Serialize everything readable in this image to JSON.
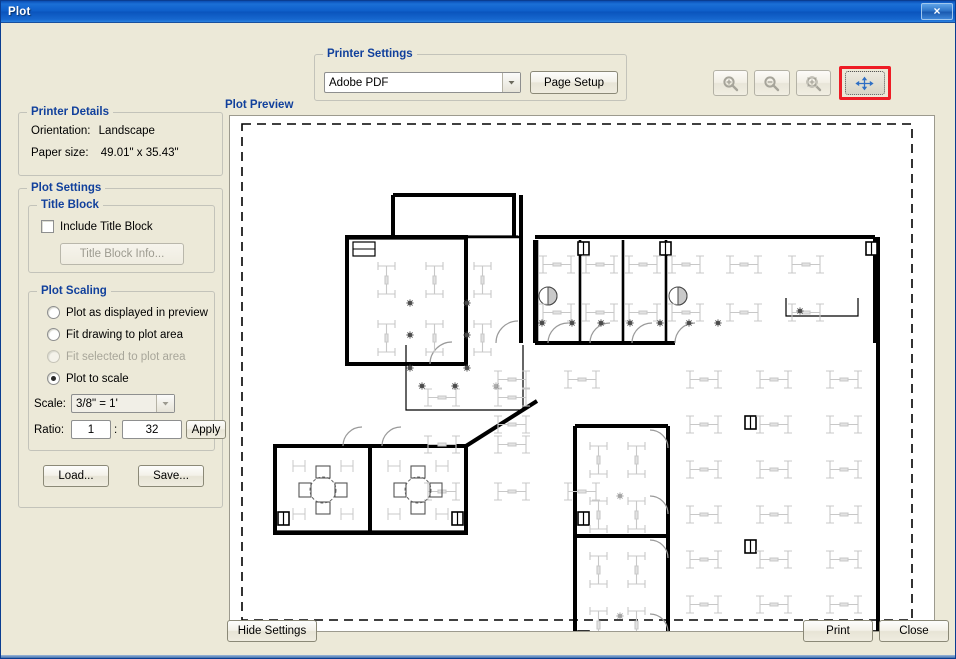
{
  "window": {
    "title": "Plot",
    "close_label": "×"
  },
  "printer_settings": {
    "legend": "Printer Settings",
    "printer_value": "Adobe PDF",
    "page_setup_label": "Page Setup"
  },
  "toolbar": {
    "zoom_in": "zoom-in-icon",
    "zoom_out": "zoom-out-icon",
    "zoom_fit": "zoom-fit-icon",
    "pan": "pan-move-icon",
    "highlight_color": "#ee1c25"
  },
  "printer_details": {
    "legend": "Printer Details",
    "orientation_label": "Orientation:",
    "orientation_value": "Landscape",
    "paper_label": "Paper size:",
    "paper_value": "49.01\" x 35.43\""
  },
  "plot_settings": {
    "legend": "Plot Settings",
    "title_block": {
      "legend": "Title Block",
      "include_label": "Include Title Block",
      "include_checked": false,
      "info_button": "Title Block Info...",
      "info_disabled": true
    },
    "plot_scaling": {
      "legend": "Plot Scaling",
      "options": [
        {
          "label": "Plot as displayed in preview",
          "selected": false,
          "disabled": false
        },
        {
          "label": "Fit drawing to plot area",
          "selected": false,
          "disabled": false
        },
        {
          "label": "Fit selected to plot area",
          "selected": false,
          "disabled": true
        },
        {
          "label": "Plot to scale",
          "selected": true,
          "disabled": false
        }
      ],
      "scale_label": "Scale:",
      "scale_value": "3/8\" = 1'",
      "ratio_label": "Ratio:",
      "ratio_numerator": "1",
      "ratio_separator": ":",
      "ratio_denominator": "32",
      "apply_label": "Apply"
    },
    "load_label": "Load...",
    "save_label": "Save..."
  },
  "preview": {
    "label": "Plot Preview",
    "paper_boundary": "dashed"
  },
  "footer": {
    "hide_settings_label": "Hide Settings",
    "print_label": "Print",
    "close_label": "Close"
  },
  "colors": {
    "accent": "#11409c",
    "dialog_bg": "#ece9d8",
    "titlebar": "#0e5ec9",
    "highlight": "#ee1c25"
  }
}
